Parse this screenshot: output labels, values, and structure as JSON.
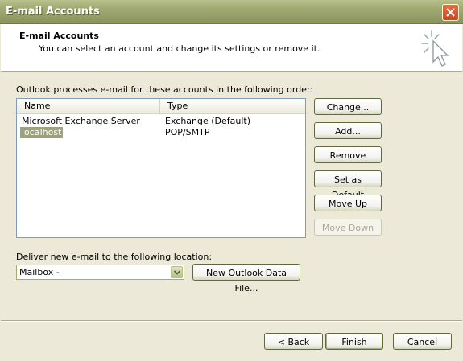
{
  "window": {
    "title": "E-mail Accounts"
  },
  "header": {
    "title": "E-mail Accounts",
    "subtitle": "You can select an account and change its settings or remove it."
  },
  "intro": "Outlook processes e-mail for these accounts in the following order:",
  "accounts_table": {
    "columns": [
      "Name",
      "Type"
    ],
    "rows": [
      {
        "name": "Microsoft Exchange Server",
        "type": "Exchange (Default)",
        "selected": false
      },
      {
        "name": "localhost",
        "type": "POP/SMTP",
        "selected": true
      }
    ]
  },
  "side_buttons": {
    "change": "Change...",
    "add": "Add...",
    "remove": "Remove",
    "set_default": "Set as Default",
    "move_up": "Move Up",
    "move_down": "Move Down"
  },
  "deliver": {
    "label": "Deliver new e-mail to the following location:",
    "value": "Mailbox -",
    "new_file_button": "New Outlook Data File..."
  },
  "footer": {
    "back": "< Back",
    "finish": "Finish",
    "cancel": "Cancel"
  },
  "colors": {
    "titlebar": "#959e66",
    "dialog_bg": "#ECE9D8",
    "selection": "#9ea27a"
  },
  "icons": [
    "close-icon",
    "wizard-cursor-icon",
    "chevron-down-icon"
  ]
}
